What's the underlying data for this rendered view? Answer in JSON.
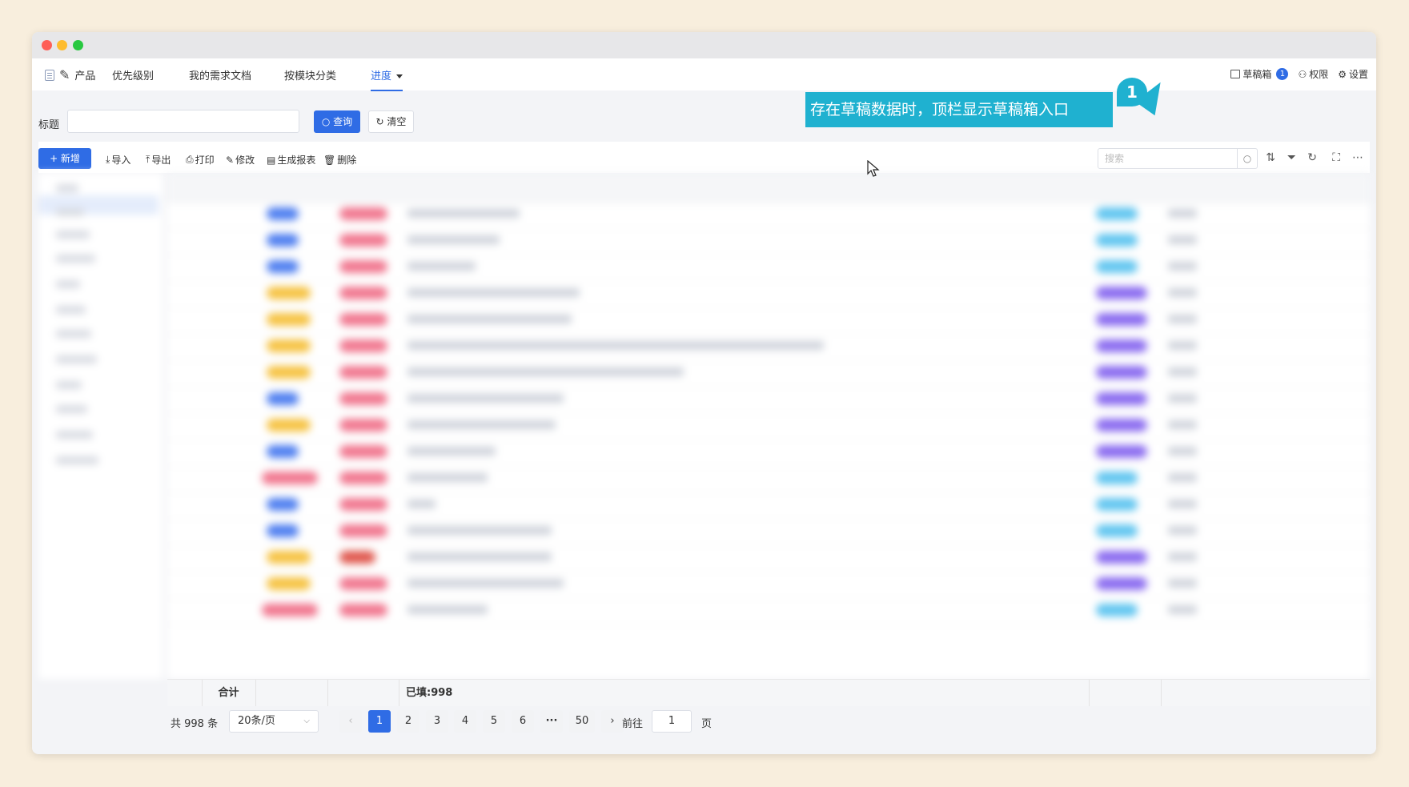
{
  "nav": {
    "brand": "产品",
    "tabs": [
      "优先级别",
      "我的需求文档",
      "按模块分类",
      "进度"
    ],
    "drafts_label": "草稿箱",
    "drafts_count": "1",
    "permissions_label": "权限",
    "settings_label": "设置"
  },
  "callout": {
    "text": "存在草稿数据时，顶栏显示草稿箱入口",
    "number": "1"
  },
  "filter": {
    "title_label": "标题",
    "title_value": "",
    "query_button": "查询",
    "clear_button": "清空"
  },
  "toolbar": {
    "add": "+ 新增",
    "import": "导入",
    "export": "导出",
    "print": "打印",
    "edit": "修改",
    "report": "生成报表",
    "delete": "删除",
    "search_placeholder": "搜索"
  },
  "totals": {
    "sum_label": "合计",
    "filled": "已填:998"
  },
  "pagination": {
    "total": "共 998 条",
    "page_size": "20条/页",
    "pages": [
      "1",
      "2",
      "3",
      "4",
      "5",
      "6",
      "···",
      "50"
    ],
    "prev": "‹",
    "next": "›",
    "goto_label": "前往",
    "goto_value": "1",
    "page_suffix": "页"
  },
  "colors": {
    "accent": "#2f6ce5",
    "callout": "#1fb1d0",
    "pill_blue": "#4f7ff0",
    "pill_yellow": "#f6c343",
    "pill_pink": "#f17890",
    "pill_cyan": "#62c6f0",
    "pill_purple": "#8b6cf0"
  }
}
